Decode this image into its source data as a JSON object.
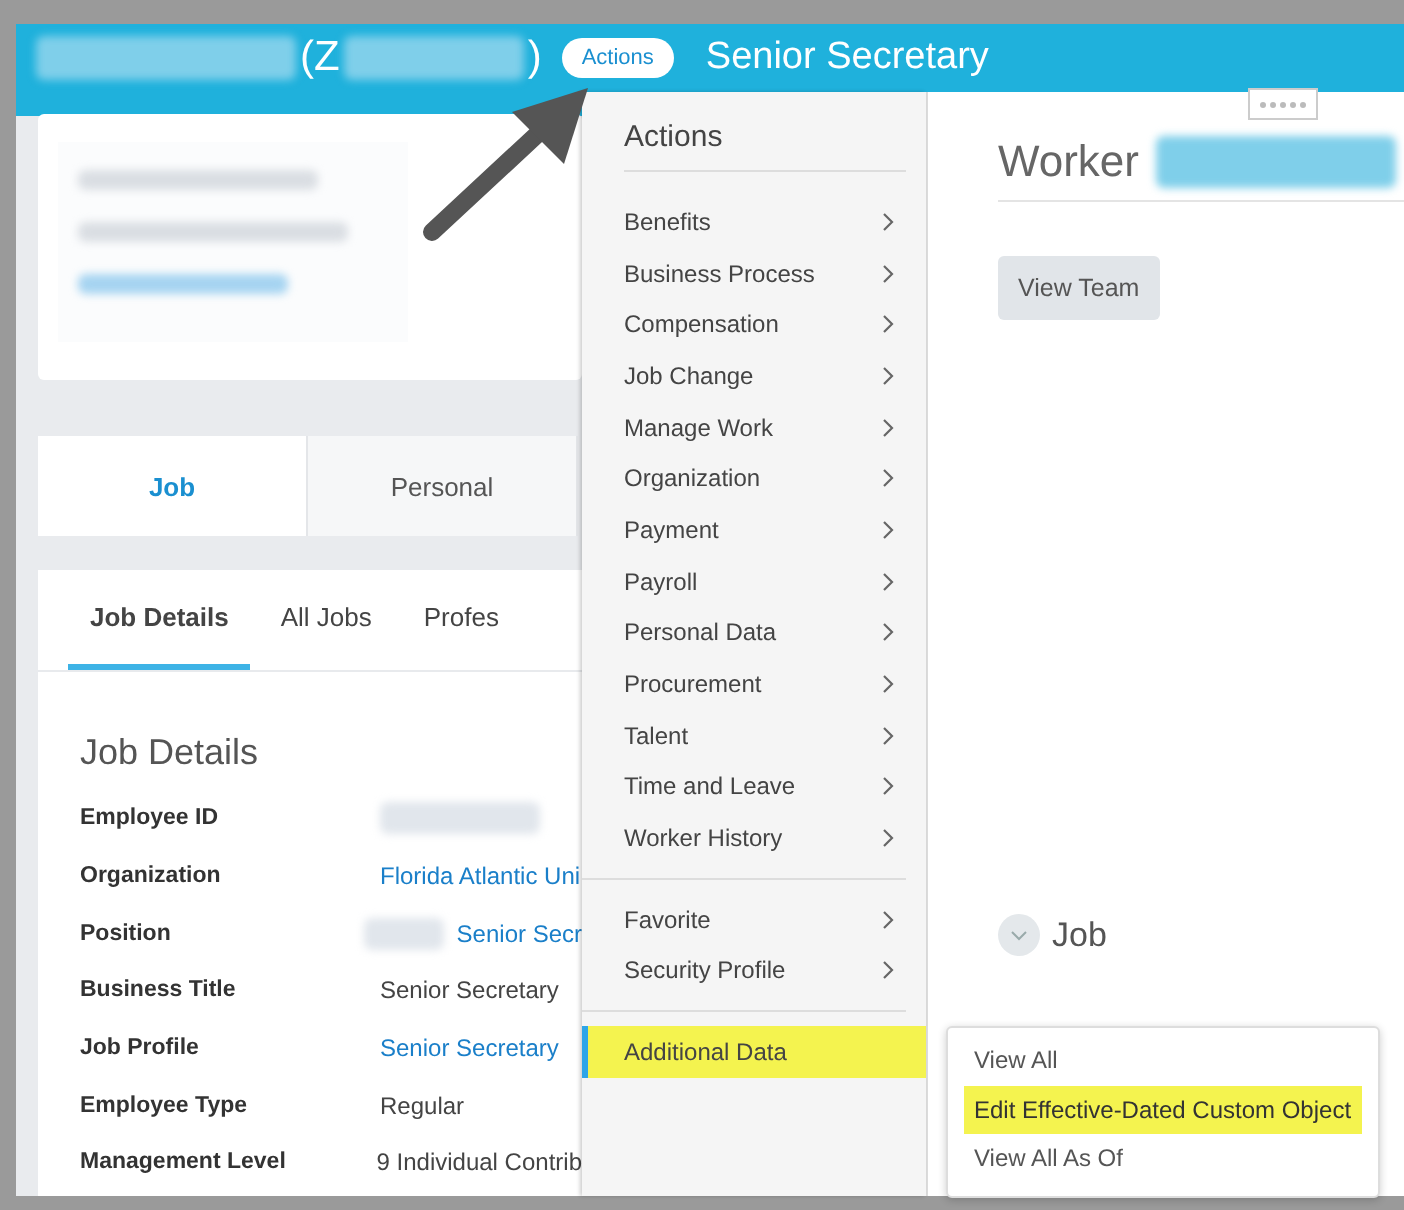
{
  "header": {
    "name_open": "(Z",
    "name_close": ")",
    "actions_button": "Actions",
    "title": "Senior Secretary"
  },
  "tabs": [
    {
      "label": "Job",
      "selected": true
    },
    {
      "label": "Personal",
      "selected": false
    }
  ],
  "subtabs": [
    {
      "label": "Job Details",
      "selected": true
    },
    {
      "label": "All Jobs",
      "selected": false
    },
    {
      "label": "Profes",
      "selected": false
    }
  ],
  "job_details": {
    "title": "Job Details",
    "fields": [
      {
        "label": "Employee ID",
        "kind": "redacted"
      },
      {
        "label": "Organization",
        "kind": "link",
        "value": "Florida Atlantic Uni"
      },
      {
        "label": "Position",
        "kind": "redacted_link",
        "value": "Senior Secr"
      },
      {
        "label": "Business Title",
        "kind": "text",
        "value": "Senior Secretary"
      },
      {
        "label": "Job Profile",
        "kind": "link",
        "value": "Senior Secretary"
      },
      {
        "label": "Employee Type",
        "kind": "text",
        "value": "Regular"
      },
      {
        "label": "Management Level",
        "kind": "text",
        "value": "9 Individual Contrib"
      }
    ]
  },
  "menu": {
    "title": "Actions",
    "groups": [
      [
        {
          "label": "Benefits",
          "has_submenu": true,
          "highlighted": false
        },
        {
          "label": "Business Process",
          "has_submenu": true,
          "highlighted": false
        },
        {
          "label": "Compensation",
          "has_submenu": true,
          "highlighted": false
        },
        {
          "label": "Job Change",
          "has_submenu": true,
          "highlighted": false
        },
        {
          "label": "Manage Work",
          "has_submenu": true,
          "highlighted": false
        },
        {
          "label": "Organization",
          "has_submenu": true,
          "highlighted": false
        },
        {
          "label": "Payment",
          "has_submenu": true,
          "highlighted": false
        },
        {
          "label": "Payroll",
          "has_submenu": true,
          "highlighted": false
        },
        {
          "label": "Personal Data",
          "has_submenu": true,
          "highlighted": false
        },
        {
          "label": "Procurement",
          "has_submenu": true,
          "highlighted": false
        },
        {
          "label": "Talent",
          "has_submenu": true,
          "highlighted": false
        },
        {
          "label": "Time and Leave",
          "has_submenu": true,
          "highlighted": false
        },
        {
          "label": "Worker History",
          "has_submenu": true,
          "highlighted": false
        }
      ],
      [
        {
          "label": "Favorite",
          "has_submenu": true,
          "highlighted": false
        },
        {
          "label": "Security Profile",
          "has_submenu": true,
          "highlighted": false
        }
      ],
      [
        {
          "label": "Additional Data",
          "has_submenu": false,
          "highlighted": true
        }
      ]
    ]
  },
  "submenu": [
    {
      "label": "View All",
      "highlighted": false
    },
    {
      "label": "Edit Effective-Dated Custom Object",
      "highlighted": true
    },
    {
      "label": "View All As Of",
      "highlighted": false
    }
  ],
  "worker": {
    "title": "Worker",
    "button": "View Team",
    "section": "Job"
  }
}
